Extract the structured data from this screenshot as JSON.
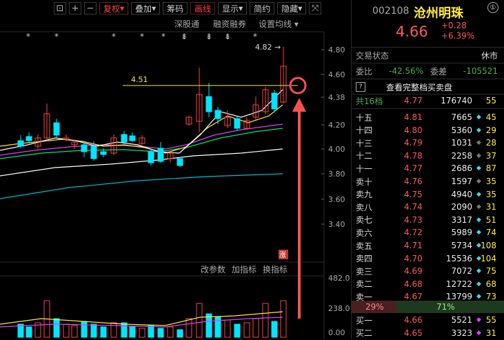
{
  "toolbar": {
    "fuquan": "复权",
    "diejia": "叠加",
    "chouma": "筹码",
    "huaxian": "画线",
    "xianshi": "显示",
    "jianyue": "简约",
    "yincang": "隐藏"
  },
  "subbar": {
    "shengutong": "深股通",
    "rongzi": "融资融券",
    "settings": "设置均线"
  },
  "chart": {
    "price_ticks": [
      "4.80",
      "4.60",
      "4.38",
      "4.20",
      "4.00",
      "3.80",
      "3.60",
      "3.40"
    ],
    "vol_ticks": [
      "482.00",
      "238.00",
      "0.00"
    ],
    "high_label": "4.82",
    "hline_label": "4.51",
    "zhang": "涨",
    "lower_btns": [
      "改参数",
      "加指标",
      "换指标"
    ]
  },
  "stock": {
    "code": "002108",
    "name": "沧州明珠",
    "info": "①",
    "price": "4.66",
    "change": "+0.28",
    "change_pct": "+6.39%",
    "status_label": "交易状态",
    "status": "休市",
    "weibi_label": "委比",
    "weibi": "-42.56%",
    "weicha_label": "委差",
    "weicha": "-105521",
    "query_icon": "?",
    "query_text": "查看完整档买卖盘",
    "total_label": "共16档",
    "total_price": "4.77",
    "total_vol": "176740",
    "total_cnt": "55"
  },
  "sells": [
    {
      "label": "十五",
      "price": "4.81",
      "vol": "7665",
      "cnt": "45",
      "dot": "#4dd0e1"
    },
    {
      "label": "十四",
      "price": "4.80",
      "vol": "5360",
      "cnt": "29",
      "dot": "#4dd0e1"
    },
    {
      "label": "十三",
      "price": "4.79",
      "vol": "1031",
      "cnt": "28",
      "dot": "#777"
    },
    {
      "label": "十二",
      "price": "4.78",
      "vol": "2258",
      "cnt": "37",
      "dot": "#777"
    },
    {
      "label": "十一",
      "price": "4.77",
      "vol": "2686",
      "cnt": "87",
      "dot": "#4dd0e1"
    },
    {
      "label": "卖十",
      "price": "4.76",
      "vol": "1597",
      "cnt": "35",
      "dot": "#777"
    },
    {
      "label": "卖九",
      "price": "4.75",
      "vol": "4940",
      "cnt": "35",
      "dot": "#4dd0e1"
    },
    {
      "label": "卖八",
      "price": "4.74",
      "vol": "2090",
      "cnt": "31",
      "dot": "#777"
    },
    {
      "label": "卖七",
      "price": "4.73",
      "vol": "3317",
      "cnt": "51",
      "dot": "#4dd0e1"
    },
    {
      "label": "卖六",
      "price": "4.72",
      "vol": "5989",
      "cnt": "74",
      "dot": "#4dd0e1"
    },
    {
      "label": "卖五",
      "price": "4.71",
      "vol": "5734",
      "cnt": "108",
      "dot": "#4dd0e1"
    },
    {
      "label": "卖四",
      "price": "4.70",
      "vol": "15536",
      "cnt": "104",
      "dot": "#4dd0e1"
    },
    {
      "label": "卖三",
      "price": "4.69",
      "vol": "7072",
      "cnt": "75",
      "dot": "#4dd0e1"
    },
    {
      "label": "卖二",
      "price": "4.68",
      "vol": "12722",
      "cnt": "68",
      "dot": "#4dd0e1"
    },
    {
      "label": "卖一",
      "price": "4.67",
      "vol": "13799",
      "cnt": "73",
      "dot": "#4dd0e1"
    }
  ],
  "ratio": {
    "sell_pct": "29%",
    "buy_pct": "71%"
  },
  "buys": [
    {
      "label": "买一",
      "price": "4.66",
      "vol": "5521",
      "cnt": "55",
      "dot": "#e040fb"
    },
    {
      "label": "买二",
      "price": "4.65",
      "vol": "3323",
      "cnt": "31",
      "dot": "#e040fb"
    }
  ],
  "colors": {
    "up": "#ff4444",
    "down": "#00e5ff",
    "ma1": "#ffffff",
    "ma2": "#ffeb3b",
    "ma3": "#e040fb",
    "ma4": "#00e676",
    "ma5": "#00bcd4",
    "arrow": "#ff5050"
  }
}
